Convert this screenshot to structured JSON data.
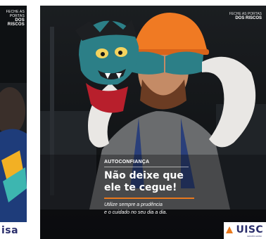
{
  "left_card": {
    "header_line1": "FECHE AS PORTAS",
    "header_line2": "DOS RISCOS",
    "logo_text": "isa"
  },
  "main_card": {
    "header_line1": "FECHE AS PORTAS",
    "header_line2": "DOS RISCOS",
    "tag": "AUTOCONFIANÇA",
    "headline_line1": "Não deixe que",
    "headline_line2": "ele te cegue!",
    "subline_line1": "Utilize sempre a prudência",
    "subline_line2": "e o cuidado no seu dia a dia.",
    "logo_text": "UISC",
    "logo_sub": "GRUPO AUISC"
  },
  "colors": {
    "accent": "#e8791d",
    "brand_navy": "#2a2e6b",
    "monster": "#2c7f87",
    "helmet": "#f07a23",
    "background": "#15181a"
  },
  "icons": {
    "left_logo": "auisc-logo-mark",
    "main_logo": "auisc-logo-mark"
  }
}
